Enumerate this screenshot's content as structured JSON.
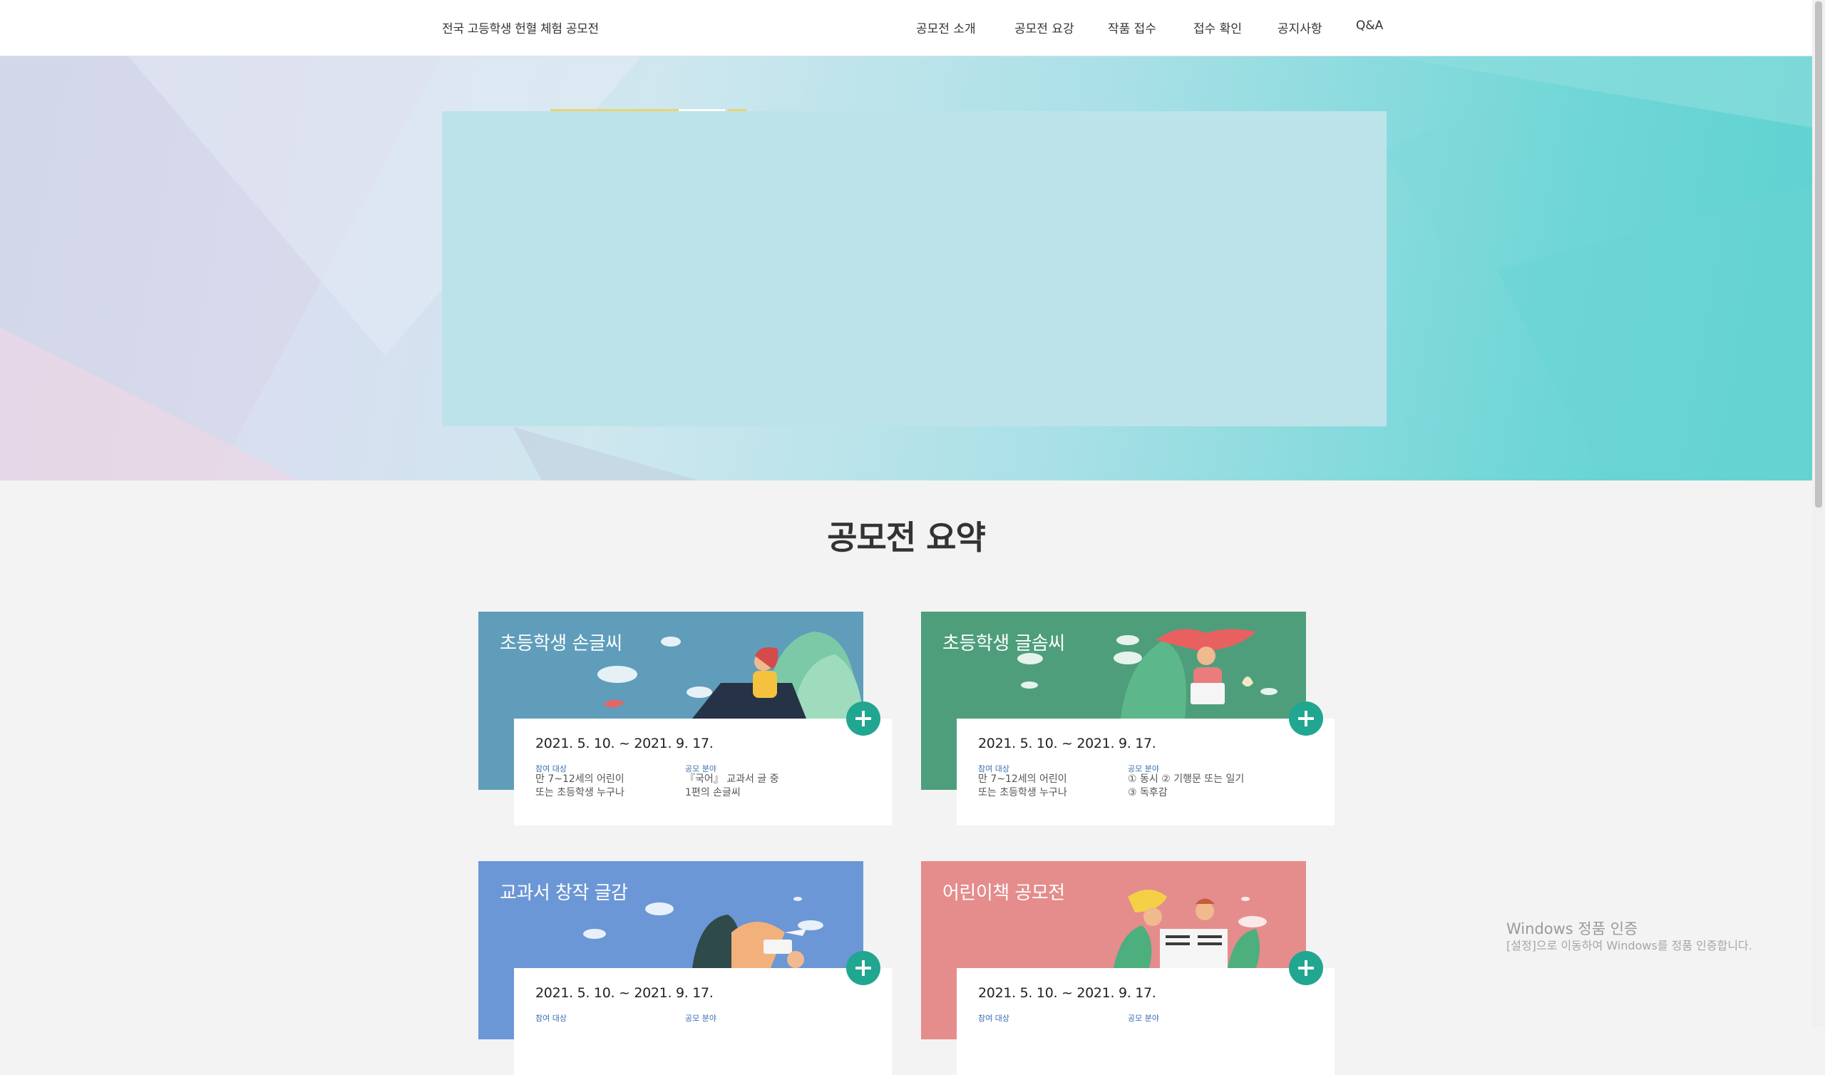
{
  "header": {
    "site_title": "전국 고등학생 헌혈 체험 공모전",
    "nav": [
      {
        "label": "공모전 소개"
      },
      {
        "label": "공모전 요강"
      },
      {
        "label": "작품 접수"
      },
      {
        "label": "접수 확인"
      },
      {
        "label": "공지사항"
      },
      {
        "label": "Q&A"
      }
    ]
  },
  "summary": {
    "title": "공모전 요약",
    "cards": [
      {
        "title": "초등학생 손글씨",
        "color": "#5f9dbb",
        "date": "2021. 5. 10. ~ 2021. 9. 17.",
        "target_label": "참여 대상",
        "target_text": "만 7~12세의 어린이\n또는 초등학생 누구나",
        "field_label": "공모 분야",
        "field_text": "『국어』 교과서 글 중\n1편의 손글씨"
      },
      {
        "title": "초등학생 글솜씨",
        "color": "#4e9e7c",
        "date": "2021. 5. 10. ~ 2021. 9. 17.",
        "target_label": "참여 대상",
        "target_text": "만 7~12세의 어린이\n또는 초등학생 누구나",
        "field_label": "공모 분야",
        "field_text": "① 동시 ② 기행문 또는 일기\n③ 독후감"
      },
      {
        "title": "교과서 창작 글감",
        "color": "#6b97d6",
        "date": "2021. 5. 10. ~ 2021. 9. 17.",
        "target_label": "참여 대상",
        "target_text": "",
        "field_label": "공모 분야",
        "field_text": ""
      },
      {
        "title": "어린이책 공모전",
        "color": "#e58c8c",
        "date": "2021. 5. 10. ~ 2021. 9. 17.",
        "target_label": "참여 대상",
        "target_text": "",
        "field_label": "공모 분야",
        "field_text": ""
      }
    ]
  },
  "watermark": {
    "title": "Windows 정품 인증",
    "subtitle": "[설정]으로 이동하여 Windows를 정품 인증합니다."
  }
}
